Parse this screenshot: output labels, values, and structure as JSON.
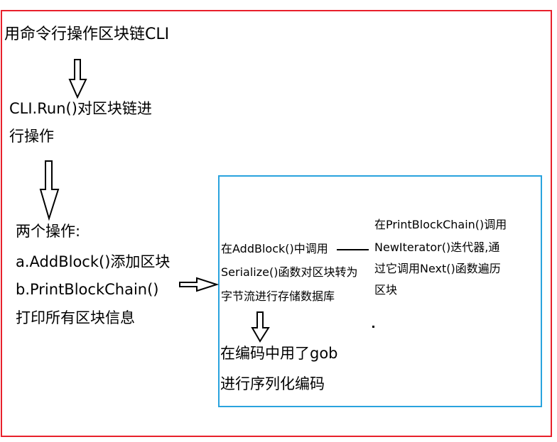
{
  "nodes": {
    "cli_title": "用命令行操作区块链CLI",
    "run_line1": "CLI.Run()对区块链进",
    "run_line2": "行操作",
    "ops_line1": "两个操作:",
    "ops_line2": "a.AddBlock()添加区块",
    "ops_line3": "b.PrintBlockChain()",
    "ops_line4": "打印所有区块信息",
    "addblock_line1": "在AddBlock()中调用",
    "addblock_line2": "Serialize()函数对区块转为",
    "addblock_line3": "字节流进行存储数据库",
    "print_line1": "在PrintBlockChain()调用",
    "print_line2": "NewIterator()迭代器,通",
    "print_line3": "过它调用Next()函数遍历",
    "print_line4": "区块",
    "gob_line1": "在编码中用了gob",
    "gob_line2": "进行序列化编码"
  },
  "colors": {
    "outer_border": "#e8202b",
    "inner_border": "#29a3de",
    "text": "#000000"
  }
}
